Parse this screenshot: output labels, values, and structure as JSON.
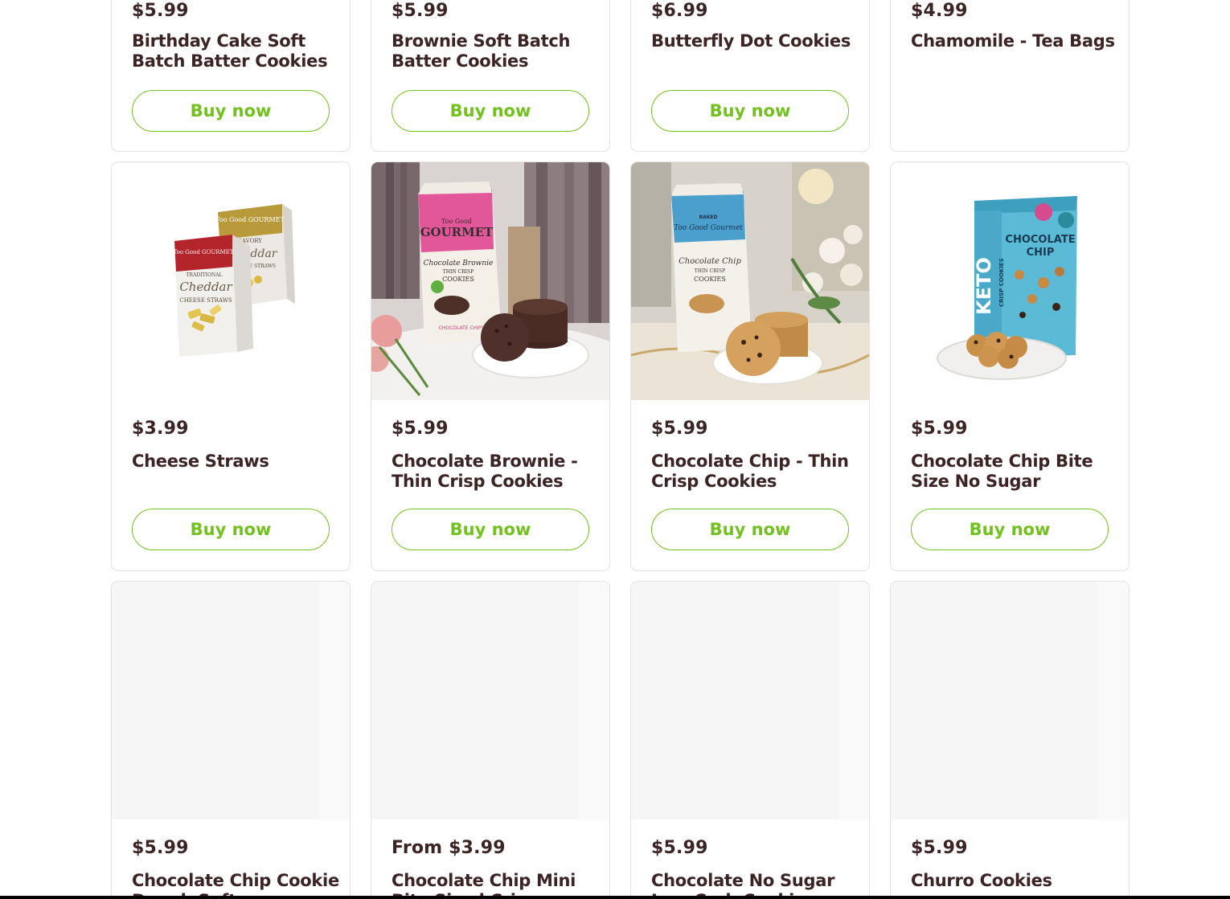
{
  "buy_label": "Buy now",
  "colors": {
    "text": "#3b2423",
    "accent": "#72c11f",
    "border": "#e6e2e2",
    "placeholder": "#f6f6f6"
  },
  "row1": [
    {
      "price": "$5.99",
      "name": "Birthday Cake Soft Batch Batter Cookies",
      "has_button": true
    },
    {
      "price": "$5.99",
      "name": "Brownie Soft Batch Batter Cookies",
      "has_button": true
    },
    {
      "price": "$6.99",
      "name": "Butterfly Dot Cookies",
      "has_button": true
    },
    {
      "price": "$4.99",
      "name": "Chamomile - Tea Bags",
      "has_button": false
    }
  ],
  "row2": [
    {
      "price": "$3.99",
      "name": "Cheese Straws",
      "image": "cheese-straws-boxes",
      "image_text": {
        "brand_a": "Too Good GOURMET",
        "brand_b": "Too Good GOURMET",
        "label_a1": "TRADITIONAL",
        "label_a2": "Cheddar",
        "label_a3": "CHEESE STRAWS",
        "label_b1": "SAVORY",
        "label_b2": "Cheddar",
        "label_b3": "CHEESE STRAWS"
      }
    },
    {
      "price": "$5.99",
      "name": "Chocolate Brownie - Thin Crisp Cookies",
      "image": "brownie-cookie-bag",
      "image_text": {
        "brand": "GOURMET",
        "brand_small": "Too Good",
        "flavor": "Chocolate Brownie",
        "sub": "THIN CRISP",
        "kind": "COOKIES",
        "chips": "CHOCOLATE CHIPS"
      }
    },
    {
      "price": "$5.99",
      "name": "Chocolate Chip - Thin Crisp Cookies",
      "image": "chip-cookie-bag",
      "image_text": {
        "brand": "Too Good Gourmet",
        "baked": "BAKED",
        "flavor": "Chocolate Chip",
        "sub": "THIN CRISP",
        "kind": "COOKIES"
      }
    },
    {
      "price": "$5.99",
      "name": "Chocolate Chip Bite Size No Sugar",
      "image": "keto-cookie-bag",
      "image_text": {
        "keto": "KETO",
        "crisp": "CRISP COOKIES",
        "flavor1": "CHOCOLATE",
        "flavor2": "CHIP"
      }
    }
  ],
  "row3": [
    {
      "price": "$5.99",
      "name": "Chocolate Chip Cookie Dough Soft"
    },
    {
      "price": "From $3.99",
      "name": "Chocolate Chip Mini Bite Sized Crisp"
    },
    {
      "price": "$5.99",
      "name": "Chocolate No Sugar Low Carb Cookies"
    },
    {
      "price": "$5.99",
      "name": "Churro Cookies"
    }
  ]
}
